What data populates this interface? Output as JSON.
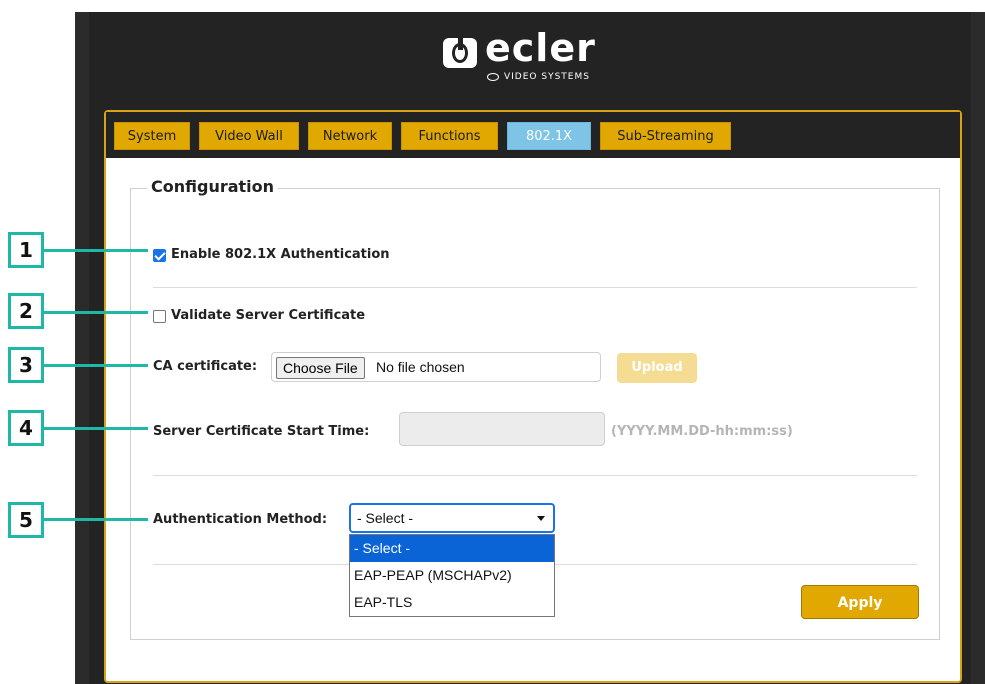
{
  "brand": {
    "name": "ecler",
    "subtitle": "VIDEO SYSTEMS"
  },
  "tabs": [
    {
      "label": "System"
    },
    {
      "label": "Video Wall"
    },
    {
      "label": "Network"
    },
    {
      "label": "Functions"
    },
    {
      "label": "802.1X",
      "active": true
    },
    {
      "label": "Sub-Streaming"
    }
  ],
  "config": {
    "legend": "Configuration",
    "enable_8021x": {
      "label": "Enable 802.1X Authentication",
      "checked": true
    },
    "validate_cert": {
      "label": "Validate Server Certificate",
      "checked": false
    },
    "ca_certificate": {
      "label": "CA certificate:",
      "choose_file_label": "Choose File",
      "file_status": "No file chosen",
      "upload_label": "Upload"
    },
    "start_time": {
      "label": "Server Certificate Start Time:",
      "value": "",
      "hint": "(YYYY.MM.DD-hh:mm:ss)"
    },
    "auth_method": {
      "label": "Authentication Method:",
      "selected": "- Select -",
      "options": [
        "- Select -",
        "EAP-PEAP (MSCHAPv2)",
        "EAP-TLS"
      ]
    },
    "apply_label": "Apply"
  },
  "callouts": [
    "1",
    "2",
    "3",
    "4",
    "5"
  ],
  "colors": {
    "tab": "#e0a800",
    "tab_active": "#7ec4e6",
    "panel_border": "#d8a417",
    "callout": "#1fb8a7",
    "select_focus": "#1a73e8"
  }
}
